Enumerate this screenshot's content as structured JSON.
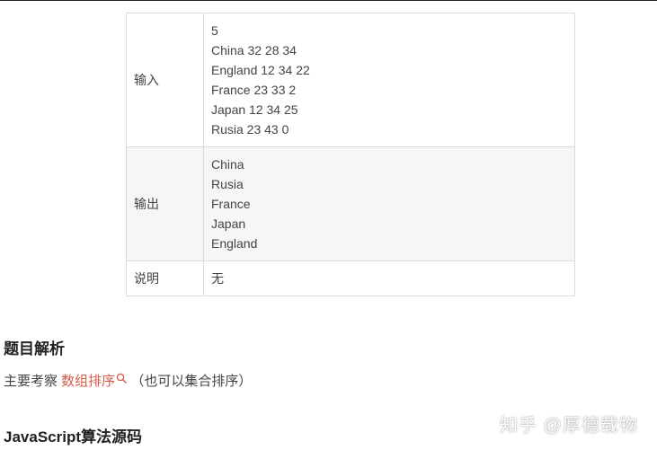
{
  "table": {
    "rows": [
      {
        "label": "输入",
        "lines": [
          "5",
          "China 32 28 34",
          "England 12 34 22",
          "France 23 33 2",
          "Japan 12 34 25",
          "Rusia 23 43 0"
        ]
      },
      {
        "label": "输出",
        "lines": [
          "China",
          "Rusia",
          "France",
          "Japan",
          "England"
        ]
      },
      {
        "label": "说明",
        "lines": [
          "无"
        ]
      }
    ]
  },
  "analysis": {
    "heading": "题目解析",
    "text_before": "主要考察 ",
    "keyword": "数组排序",
    "text_after": " （也可以集合排序）",
    "keyword_color": "#d65a4a"
  },
  "code_section": {
    "heading": "JavaScript算法源码"
  },
  "watermark": "知乎 @厚德载物"
}
